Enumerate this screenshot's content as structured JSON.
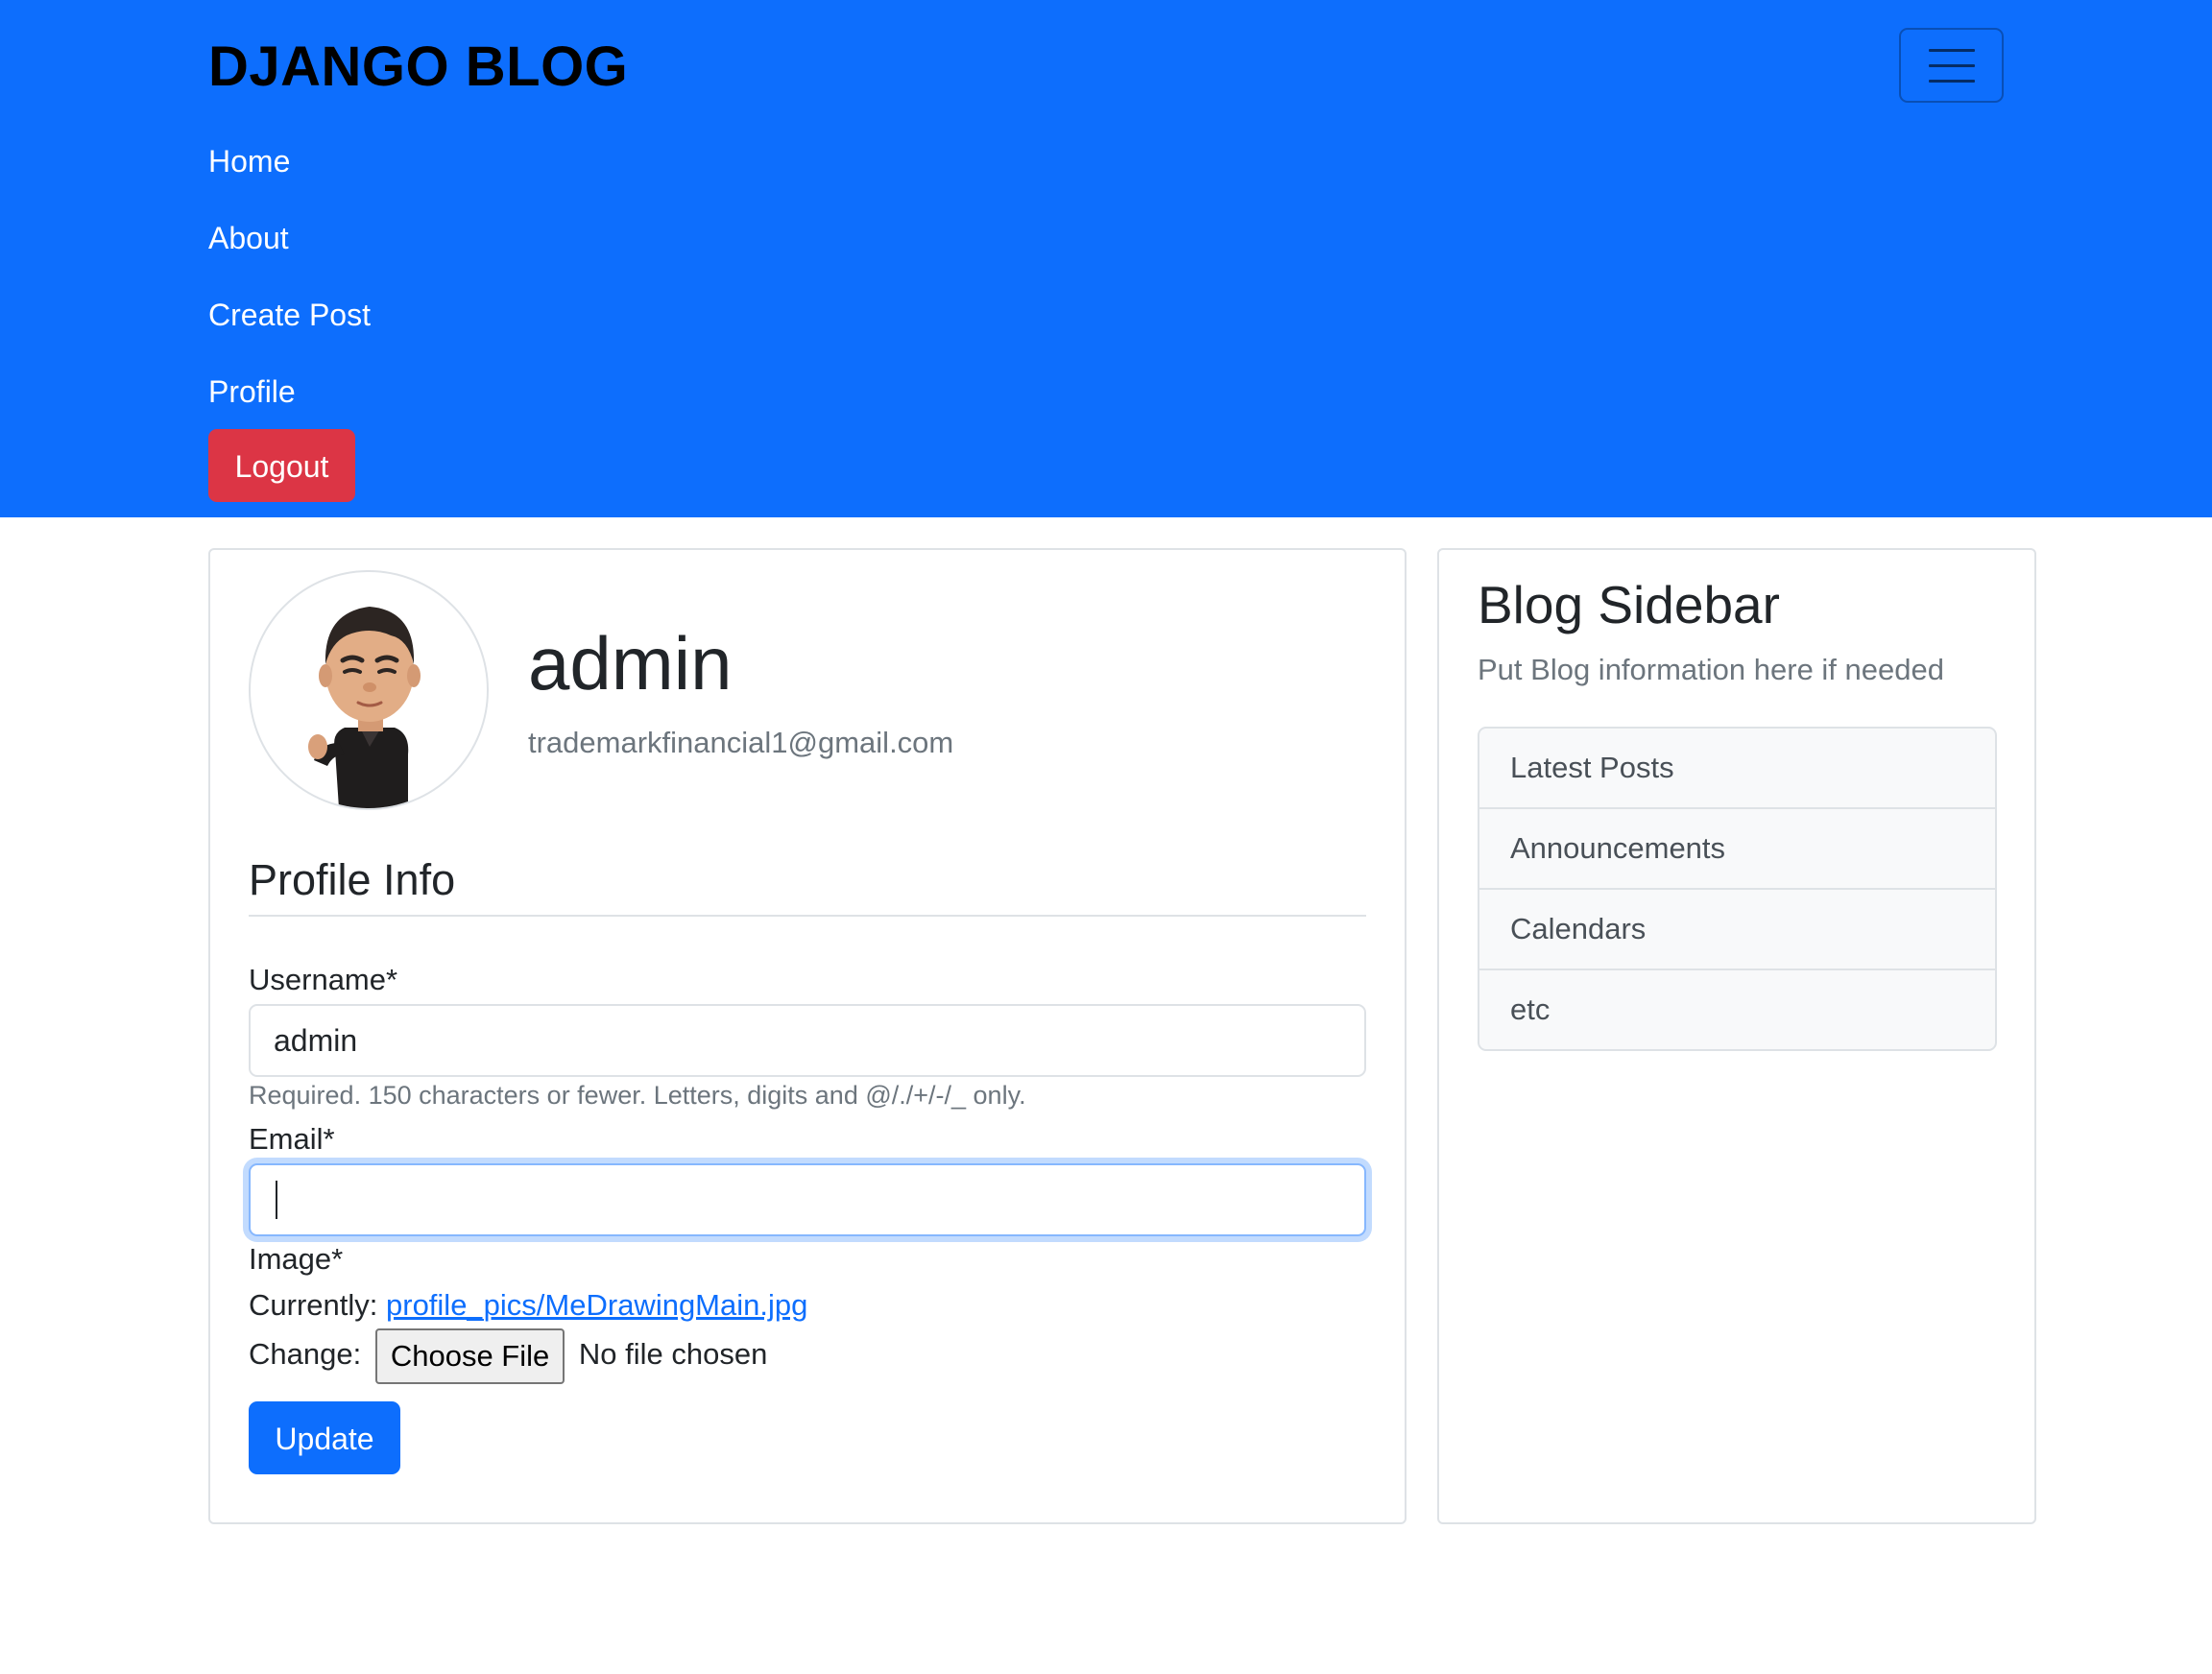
{
  "navbar": {
    "brand": "DJANGO BLOG",
    "links": [
      "Home",
      "About",
      "Create Post",
      "Profile"
    ],
    "logout_label": "Logout",
    "color": "#0d6efd"
  },
  "profile": {
    "username": "admin",
    "email": "trademarkfinancial1@gmail.com"
  },
  "form": {
    "legend": "Profile Info",
    "username_label": "Username*",
    "username_value": "admin",
    "username_help": "Required. 150 characters or fewer. Letters, digits and @/./+/-/_ only.",
    "email_label": "Email*",
    "email_value": "",
    "image_label": "Image*",
    "currently_label": "Currently:",
    "current_file": "profile_pics/MeDrawingMain.jpg",
    "change_label": "Change:",
    "choose_file_label": "Choose File",
    "no_file_text": "No file chosen",
    "update_label": "Update"
  },
  "sidebar": {
    "title": "Blog Sidebar",
    "text": "Put Blog information here if needed",
    "items": [
      "Latest Posts",
      "Announcements",
      "Calendars",
      "etc"
    ]
  },
  "colors": {
    "primary": "#0d6efd",
    "danger": "#dc3545",
    "muted": "#6c757d"
  }
}
